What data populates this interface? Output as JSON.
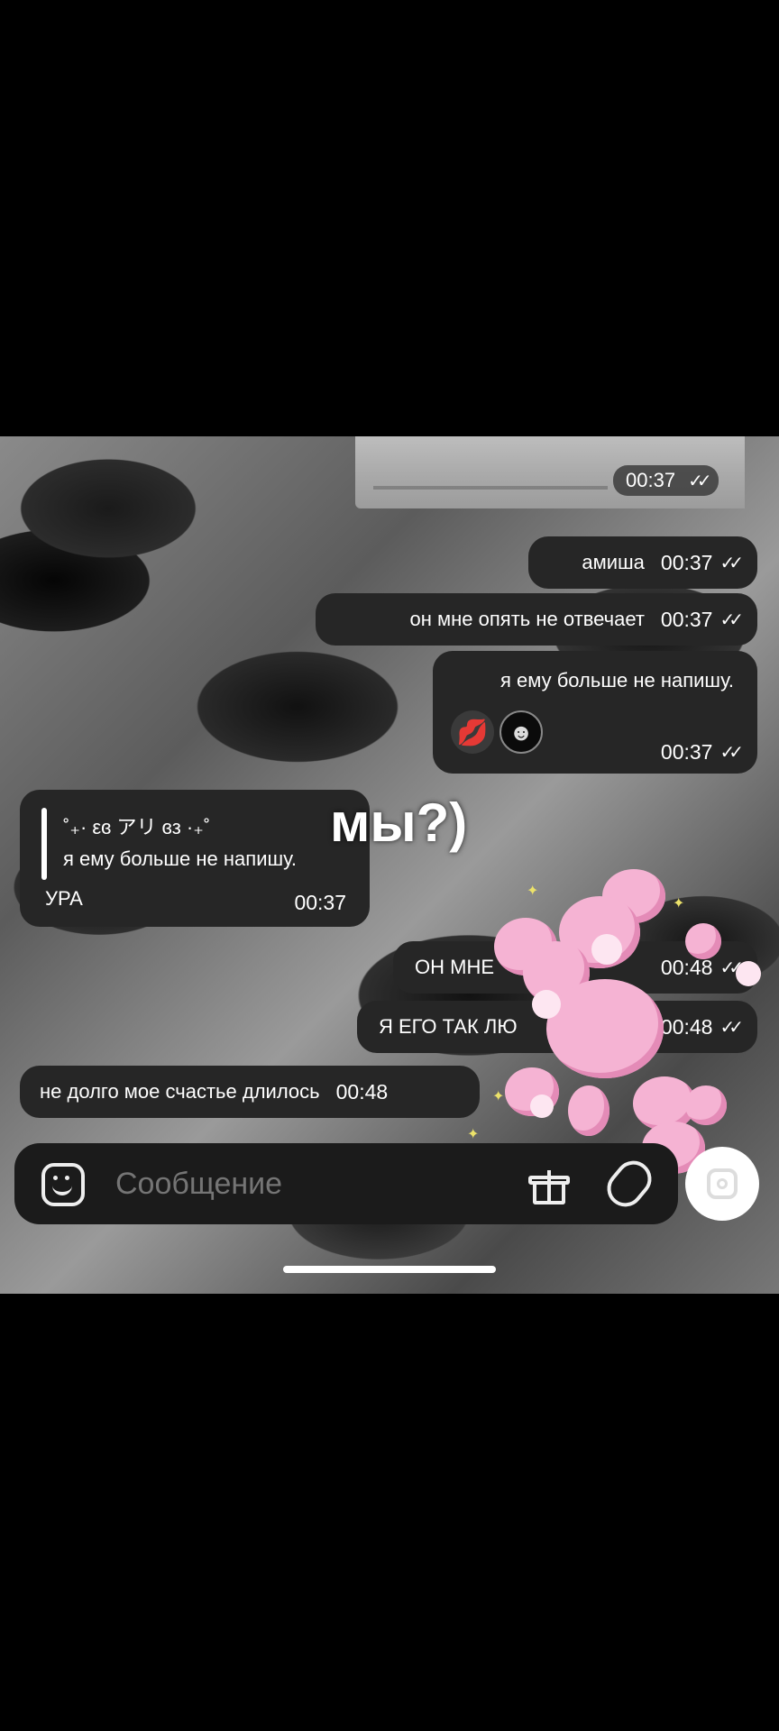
{
  "photo_message": {
    "time": "00:37"
  },
  "messages": [
    {
      "id": "m1",
      "text": "амиша",
      "time": "00:37"
    },
    {
      "id": "m2",
      "text": "он мне опять не отвечает",
      "time": "00:37"
    },
    {
      "id": "m3",
      "text": "я ему больше не напишу.",
      "emojis": [
        "💋",
        "☻"
      ],
      "time": "00:37"
    },
    {
      "id": "m4",
      "reply_name": "˚₊· εɞ アリ ɞз ·₊˚",
      "reply_text": "я ему больше не напишу.",
      "text": "УРА",
      "time": "00:37"
    },
    {
      "id": "m5",
      "text": "ОН МНЕ",
      "time": "00:48"
    },
    {
      "id": "m6",
      "text": "Я ЕГО ТАК ЛЮ",
      "time": "00:48"
    },
    {
      "id": "m7",
      "text": "не долго мое счастье длилось",
      "time": "00:48"
    }
  ],
  "overlay_text": "мы?)",
  "composer": {
    "placeholder": "Сообщение"
  },
  "icons": [
    "sticker-icon",
    "gift-icon",
    "paperclip-icon",
    "camera-icon",
    "double-check-icon"
  ],
  "colors": {
    "bubble": "#262626",
    "sticker_pink": "#f5b3d3"
  }
}
